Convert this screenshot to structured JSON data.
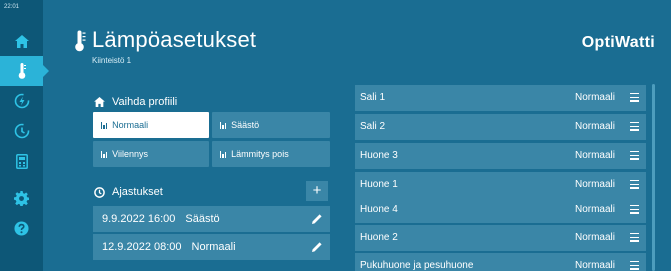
{
  "status": {
    "clock": "22:01"
  },
  "sidebar": {
    "items": [
      {
        "icon": "home-icon"
      },
      {
        "icon": "thermometer-icon",
        "active": true
      },
      {
        "icon": "energy-icon"
      },
      {
        "icon": "clock-cycle-icon"
      },
      {
        "icon": "calculator-icon"
      },
      {
        "icon": "gear-icon"
      },
      {
        "icon": "help-icon"
      }
    ]
  },
  "header": {
    "title": "Lämpöasetukset",
    "subtitle": "Kiinteistö 1",
    "brand": "OptiWatti"
  },
  "profiles": {
    "title": "Vaihda profiili",
    "buttons": [
      {
        "label": "Normaali",
        "selected": true
      },
      {
        "label": "Säästö",
        "selected": false
      },
      {
        "label": "Viilennys",
        "selected": false
      },
      {
        "label": "Lämmitys pois",
        "selected": false
      }
    ]
  },
  "schedules": {
    "title": "Ajastukset",
    "add_label": "+",
    "items": [
      {
        "datetime": "9.9.2022 16:00",
        "profile": "Säästö"
      },
      {
        "datetime": "12.9.2022 08:00",
        "profile": "Normaali"
      }
    ]
  },
  "rooms": [
    {
      "name": "Sali 1",
      "mode": "Normaali"
    },
    {
      "name": "Sali 2",
      "mode": "Normaali"
    },
    {
      "name": "Huone 3",
      "mode": "Normaali"
    },
    {
      "name": "Huone 1",
      "mode": "Normaali"
    },
    {
      "name": "Huone 4",
      "mode": "Normaali"
    },
    {
      "name": "Huone 2",
      "mode": "Normaali"
    },
    {
      "name": "Pukuhuone ja pesuhuone",
      "mode": "Normaali"
    }
  ],
  "colors": {
    "background": "#1a6d92",
    "sidebar": "#0d5777",
    "accent": "#2bb3d8",
    "row": "#3a86a7"
  }
}
